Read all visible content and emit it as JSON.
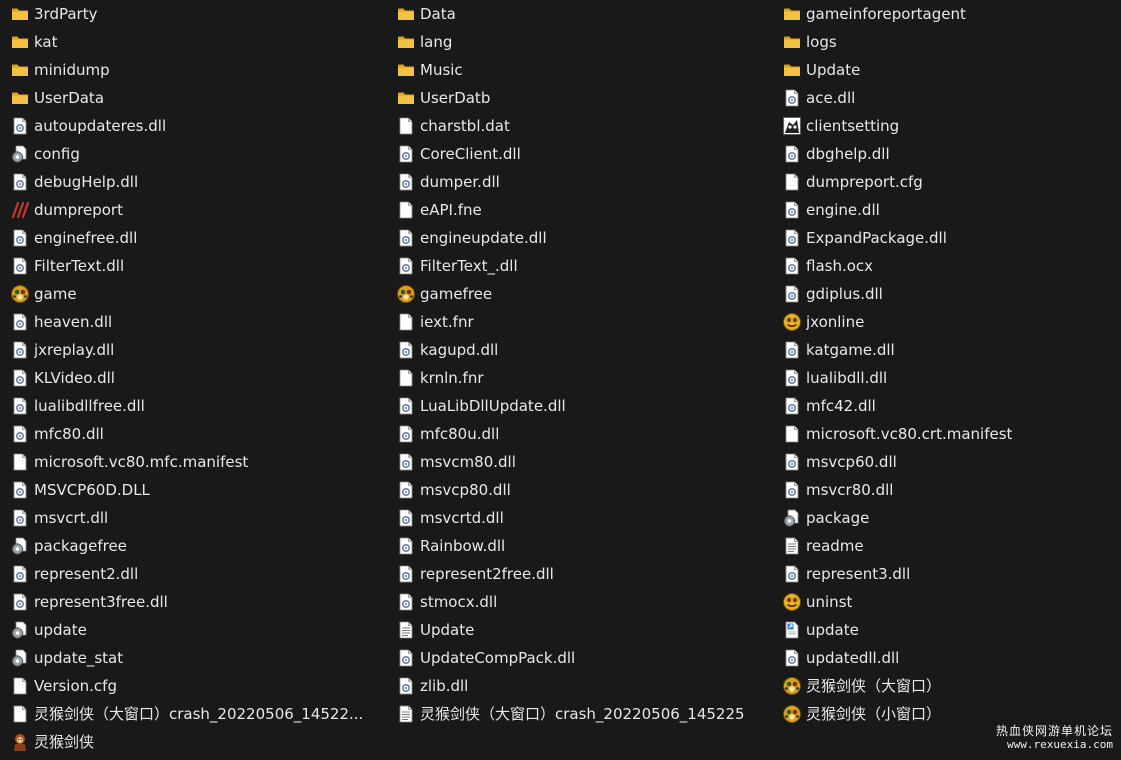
{
  "columns": [
    [
      {
        "name": "3rdParty",
        "icon": "folder-icon"
      },
      {
        "name": "kat",
        "icon": "folder-icon"
      },
      {
        "name": "minidump",
        "icon": "folder-icon"
      },
      {
        "name": "UserData",
        "icon": "folder-icon"
      },
      {
        "name": "autoupdateres.dll",
        "icon": "dll-icon"
      },
      {
        "name": "config",
        "icon": "gear-file-icon"
      },
      {
        "name": "debugHelp.dll",
        "icon": "dll-icon"
      },
      {
        "name": "dumpreport",
        "icon": "claw-app-icon"
      },
      {
        "name": "enginefree.dll",
        "icon": "dll-icon"
      },
      {
        "name": "FilterText.dll",
        "icon": "dll-icon"
      },
      {
        "name": "game",
        "icon": "game-app-icon"
      },
      {
        "name": "heaven.dll",
        "icon": "dll-icon"
      },
      {
        "name": "jxreplay.dll",
        "icon": "dll-icon"
      },
      {
        "name": "KLVideo.dll",
        "icon": "dll-icon"
      },
      {
        "name": "lualibdllfree.dll",
        "icon": "dll-icon"
      },
      {
        "name": "mfc80.dll",
        "icon": "dll-icon"
      },
      {
        "name": "microsoft.vc80.mfc.manifest",
        "icon": "blank-file-icon"
      },
      {
        "name": "MSVCP60D.DLL",
        "icon": "dll-icon"
      },
      {
        "name": "msvcrt.dll",
        "icon": "dll-icon"
      },
      {
        "name": "packagefree",
        "icon": "gear-file-icon"
      },
      {
        "name": "represent2.dll",
        "icon": "dll-icon"
      },
      {
        "name": "represent3free.dll",
        "icon": "dll-icon"
      },
      {
        "name": "update",
        "icon": "gear-file-icon"
      },
      {
        "name": "update_stat",
        "icon": "gear-file-icon"
      },
      {
        "name": "Version.cfg",
        "icon": "blank-file-icon"
      },
      {
        "name": "灵猴剑侠（大窗口）crash_20220506_14522...",
        "icon": "blank-file-icon"
      },
      {
        "name": "灵猴剑侠",
        "icon": "monkey-app-icon"
      }
    ],
    [
      {
        "name": "Data",
        "icon": "folder-icon"
      },
      {
        "name": "lang",
        "icon": "folder-icon"
      },
      {
        "name": "Music",
        "icon": "folder-icon"
      },
      {
        "name": "UserDatb",
        "icon": "folder-icon"
      },
      {
        "name": "charstbl.dat",
        "icon": "blank-file-icon"
      },
      {
        "name": "CoreClient.dll",
        "icon": "dll-icon"
      },
      {
        "name": "dumper.dll",
        "icon": "dll-icon"
      },
      {
        "name": "eAPI.fne",
        "icon": "blank-file-icon"
      },
      {
        "name": "engineupdate.dll",
        "icon": "dll-icon"
      },
      {
        "name": "FilterText_.dll",
        "icon": "dll-icon"
      },
      {
        "name": "gamefree",
        "icon": "game-app-icon"
      },
      {
        "name": "iext.fnr",
        "icon": "blank-file-icon"
      },
      {
        "name": "kagupd.dll",
        "icon": "dll-icon"
      },
      {
        "name": "krnln.fnr",
        "icon": "blank-file-icon"
      },
      {
        "name": "LuaLibDllUpdate.dll",
        "icon": "dll-icon"
      },
      {
        "name": "mfc80u.dll",
        "icon": "dll-icon"
      },
      {
        "name": "msvcm80.dll",
        "icon": "dll-icon"
      },
      {
        "name": "msvcp80.dll",
        "icon": "dll-icon"
      },
      {
        "name": "msvcrtd.dll",
        "icon": "dll-icon"
      },
      {
        "name": "Rainbow.dll",
        "icon": "dll-icon"
      },
      {
        "name": "represent2free.dll",
        "icon": "dll-icon"
      },
      {
        "name": "stmocx.dll",
        "icon": "dll-icon"
      },
      {
        "name": "Update",
        "icon": "text-file-icon"
      },
      {
        "name": "UpdateCompPack.dll",
        "icon": "dll-icon"
      },
      {
        "name": "zlib.dll",
        "icon": "dll-icon"
      },
      {
        "name": "灵猴剑侠（大窗口）crash_20220506_145225",
        "icon": "text-file-icon"
      }
    ],
    [
      {
        "name": "gameinforeportagent",
        "icon": "folder-icon"
      },
      {
        "name": "logs",
        "icon": "folder-icon"
      },
      {
        "name": "Update",
        "icon": "folder-icon"
      },
      {
        "name": "ace.dll",
        "icon": "dll-icon"
      },
      {
        "name": "clientsetting",
        "icon": "panda-app-icon"
      },
      {
        "name": "dbghelp.dll",
        "icon": "dll-icon"
      },
      {
        "name": "dumpreport.cfg",
        "icon": "blank-file-icon"
      },
      {
        "name": "engine.dll",
        "icon": "dll-icon"
      },
      {
        "name": "ExpandPackage.dll",
        "icon": "dll-icon"
      },
      {
        "name": "flash.ocx",
        "icon": "dll-icon"
      },
      {
        "name": "gdiplus.dll",
        "icon": "dll-icon"
      },
      {
        "name": "jxonline",
        "icon": "yellow-app-icon"
      },
      {
        "name": "katgame.dll",
        "icon": "dll-icon"
      },
      {
        "name": "lualibdll.dll",
        "icon": "dll-icon"
      },
      {
        "name": "mfc42.dll",
        "icon": "dll-icon"
      },
      {
        "name": "microsoft.vc80.crt.manifest",
        "icon": "blank-file-icon"
      },
      {
        "name": "msvcp60.dll",
        "icon": "dll-icon"
      },
      {
        "name": "msvcr80.dll",
        "icon": "dll-icon"
      },
      {
        "name": "package",
        "icon": "gear-file-icon"
      },
      {
        "name": "readme",
        "icon": "text-file-icon"
      },
      {
        "name": "represent3.dll",
        "icon": "dll-icon"
      },
      {
        "name": "uninst",
        "icon": "yellow-app-icon"
      },
      {
        "name": "update",
        "icon": "blue-app-icon"
      },
      {
        "name": "updatedll.dll",
        "icon": "dll-icon"
      },
      {
        "name": "灵猴剑侠（大窗口）",
        "icon": "game-app-icon"
      },
      {
        "name": "灵猴剑侠（小窗口）",
        "icon": "game-app-icon"
      }
    ]
  ],
  "watermark": {
    "title": "热血侠网游单机论坛",
    "url": "www.rexuexia.com"
  },
  "colors": {
    "background": "#191919",
    "text": "#e8e8e8",
    "folder": "#f3c144",
    "folder_dark": "#d9a21c"
  }
}
